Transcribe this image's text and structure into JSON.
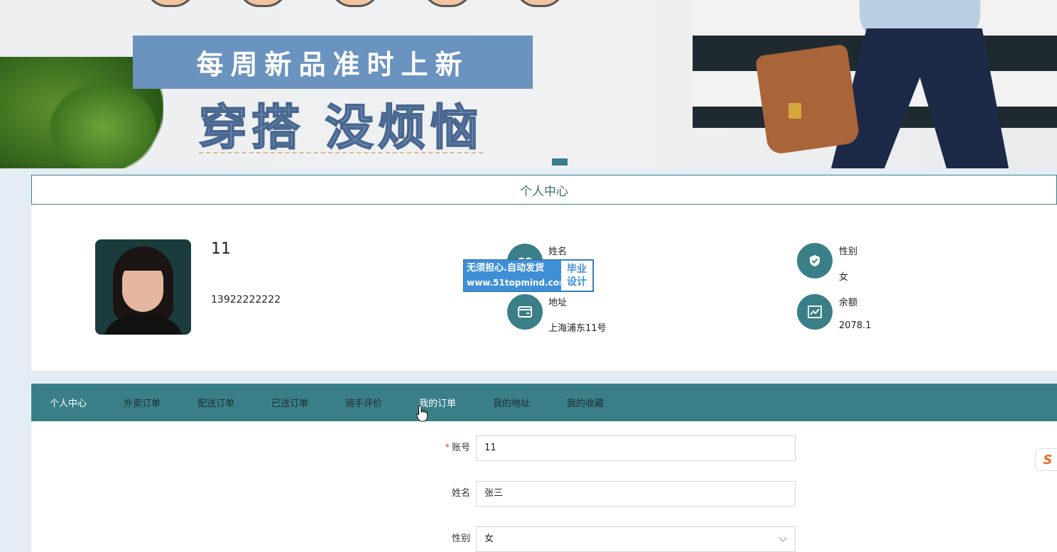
{
  "banner": {
    "slogan_top": "每周新品准时上新",
    "slogan_main": "穿搭 没烦恼"
  },
  "section_title": "个人中心",
  "profile": {
    "name": "11",
    "phone": "13922222222",
    "info": [
      {
        "label": "姓名",
        "value": "",
        "icon": "glasses-icon"
      },
      {
        "label": "地址",
        "value": "上海浦东11号",
        "icon": "wallet-icon"
      },
      {
        "label": "性别",
        "value": "女",
        "icon": "shield-check-icon"
      },
      {
        "label": "余额",
        "value": "2078.1",
        "icon": "chart-icon"
      }
    ]
  },
  "watermark": {
    "line1": "无须担心.自动发货",
    "url": "www.51topmind.com",
    "tag_line1": "毕业",
    "tag_line2": "设计"
  },
  "nav": {
    "items": [
      "个人中心",
      "外卖订单",
      "配送订单",
      "已送订单",
      "骑手评价",
      "我的订单",
      "我的地址",
      "我的收藏"
    ]
  },
  "form": {
    "account": {
      "label": "账号",
      "required": "*",
      "value": "11"
    },
    "name": {
      "label": "姓名",
      "value": "张三"
    },
    "gender": {
      "label": "性别",
      "value": "女"
    }
  },
  "side_widget": {
    "label": "S"
  },
  "colors": {
    "primary": "#3a7f88",
    "required": "#e04b3a",
    "watermark": "#3f8fd6"
  }
}
